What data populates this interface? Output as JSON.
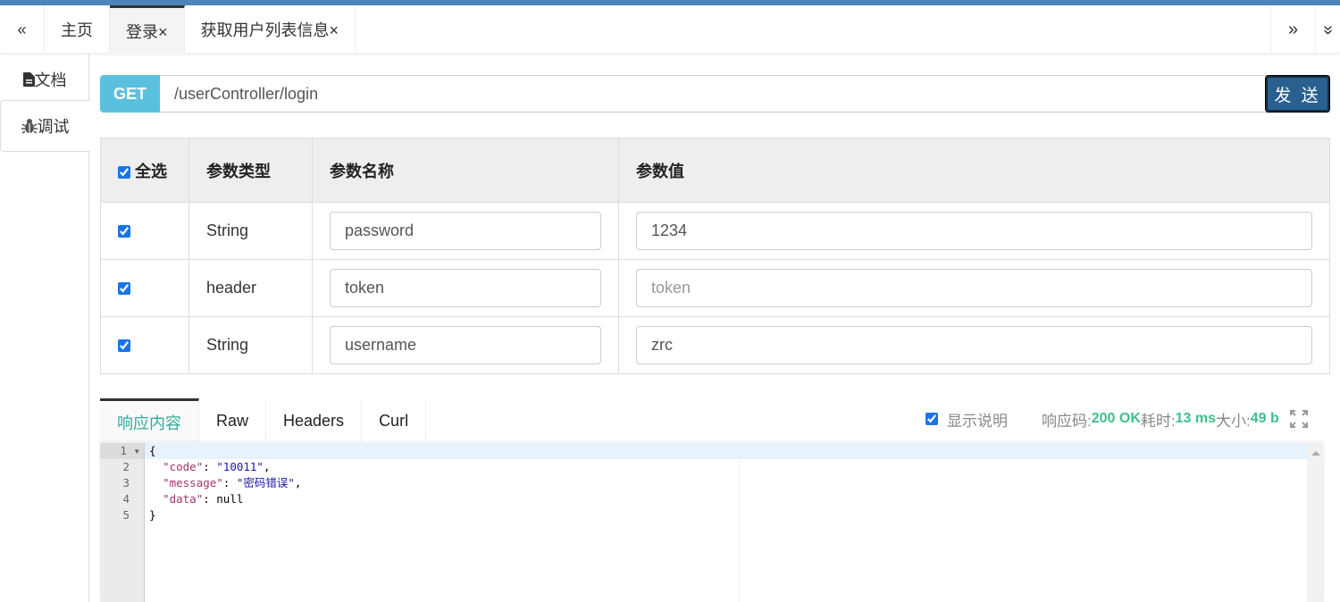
{
  "tabs": {
    "prev_icon": "«",
    "next_icon": "»",
    "items": [
      {
        "label": "主页",
        "active": false
      },
      {
        "label": "登录×",
        "active": true
      },
      {
        "label": "获取用户列表信息×",
        "active": false
      }
    ]
  },
  "sidebar": {
    "items": [
      {
        "label": "文档",
        "icon": "file-icon"
      },
      {
        "label": "调试",
        "icon": "bug-icon",
        "active": true
      }
    ]
  },
  "request": {
    "method": "GET",
    "url": "/userController/login",
    "send_label": "发 送"
  },
  "params": {
    "headers": [
      "全选",
      "参数类型",
      "参数名称",
      "参数值"
    ],
    "rows": [
      {
        "checked": true,
        "type": "String",
        "name": "password",
        "value": "1234",
        "placeholder": ""
      },
      {
        "checked": true,
        "type": "header",
        "name": "token",
        "value": "",
        "placeholder": "token"
      },
      {
        "checked": true,
        "type": "String",
        "name": "username",
        "value": "zrc",
        "placeholder": ""
      }
    ]
  },
  "response": {
    "tabs": [
      "响应内容",
      "Raw",
      "Headers",
      "Curl"
    ],
    "show_desc_label": "显示说明",
    "show_desc_checked": true,
    "code_label": "响应码:",
    "code_value": "200 OK",
    "time_label": "耗时:",
    "time_value": "13 ms",
    "size_label": "大小:",
    "size_value": "49 b",
    "body_lines": [
      [
        [
          "p",
          "{"
        ]
      ],
      [
        [
          "p",
          "  "
        ],
        [
          "k",
          "\"code\""
        ],
        [
          "p",
          ": "
        ],
        [
          "s",
          "\"10011\""
        ],
        [
          "p",
          ","
        ]
      ],
      [
        [
          "p",
          "  "
        ],
        [
          "k",
          "\"message\""
        ],
        [
          "p",
          ": "
        ],
        [
          "s",
          "\"密码错误\""
        ],
        [
          "p",
          ","
        ]
      ],
      [
        [
          "p",
          "  "
        ],
        [
          "k",
          "\"data\""
        ],
        [
          "p",
          ": null"
        ]
      ],
      [
        [
          "p",
          "}"
        ]
      ]
    ]
  },
  "colors": {
    "accent": "#4a86bb",
    "method": "#5bc0de",
    "send": "#286090",
    "success": "#3fbf8a"
  }
}
